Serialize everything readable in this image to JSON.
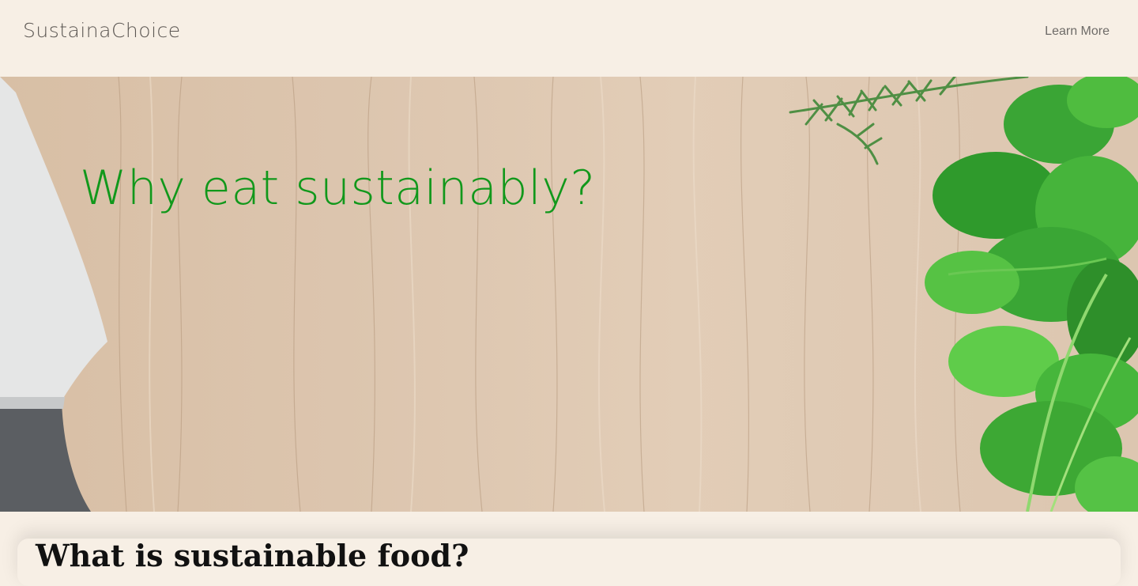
{
  "header": {
    "brand": "SustainaChoice",
    "nav_link": "Learn More"
  },
  "hero": {
    "title": "Why eat sustainably?",
    "background_icons": {
      "knife": "knife-icon",
      "rosemary": "rosemary-icon",
      "parsley": "parsley-icon"
    },
    "colors": {
      "title": "#11981b",
      "wood": "#dcc5ae",
      "herb": "#2fb12a"
    }
  },
  "content": {
    "section_title": "What is sustainable food?"
  },
  "colors": {
    "page_background": "#f7efe5",
    "brand_text": "#5b5652",
    "nav_text": "#6e6b68"
  }
}
